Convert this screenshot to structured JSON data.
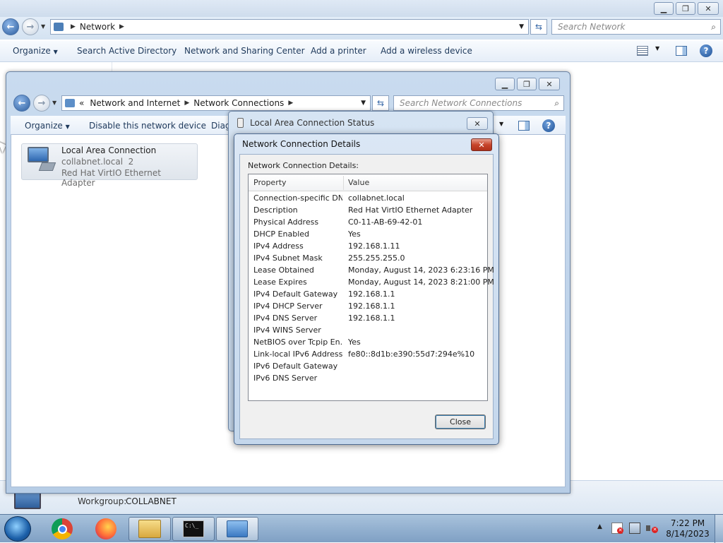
{
  "main_window": {
    "address_crumb": "Network",
    "search_placeholder": "Search Network",
    "commands": [
      "Organize",
      "Search Active Directory",
      "Network and Sharing Center",
      "Add a printer",
      "Add a wireless device"
    ],
    "status_workgroup_label": "Workgroup:",
    "status_workgroup_value": "COLLABNET"
  },
  "nc_window": {
    "breadcrumb_prefix": "«",
    "breadcrumb": [
      "Network and Internet",
      "Network Connections"
    ],
    "search_placeholder": "Search Network Connections",
    "commands": [
      "Organize",
      "Disable this network device",
      "Diag"
    ],
    "connection": {
      "name": "Local Area Connection",
      "network": "collabnet.local  2",
      "adapter": "Red Hat VirtIO Ethernet Adapter"
    }
  },
  "status_dialog": {
    "title": "Local Area Connection Status",
    "close_glyph": "✕"
  },
  "details_dialog": {
    "title": "Network Connection Details",
    "label": "Network Connection Details:",
    "columns": [
      "Property",
      "Value"
    ],
    "rows": [
      {
        "property": "Connection-specific DN...",
        "value": "collabnet.local"
      },
      {
        "property": "Description",
        "value": "Red Hat VirtIO Ethernet Adapter"
      },
      {
        "property": "Physical Address",
        "value": "C0-11-AB-69-42-01"
      },
      {
        "property": "DHCP Enabled",
        "value": "Yes"
      },
      {
        "property": "IPv4 Address",
        "value": "192.168.1.11"
      },
      {
        "property": "IPv4 Subnet Mask",
        "value": "255.255.255.0"
      },
      {
        "property": "Lease Obtained",
        "value": "Monday, August 14, 2023 6:23:16 PM"
      },
      {
        "property": "Lease Expires",
        "value": "Monday, August 14, 2023 8:21:00 PM"
      },
      {
        "property": "IPv4 Default Gateway",
        "value": "192.168.1.1"
      },
      {
        "property": "IPv4 DHCP Server",
        "value": "192.168.1.1"
      },
      {
        "property": "IPv4 DNS Server",
        "value": "192.168.1.1"
      },
      {
        "property": "IPv4 WINS Server",
        "value": ""
      },
      {
        "property": "NetBIOS over Tcpip En...",
        "value": "Yes"
      },
      {
        "property": "Link-local IPv6 Address",
        "value": "fe80::8d1b:e390:55d7:294e%10"
      },
      {
        "property": "IPv6 Default Gateway",
        "value": ""
      },
      {
        "property": "IPv6 DNS Server",
        "value": ""
      }
    ],
    "close_button": "Close"
  },
  "taskbar": {
    "icons": [
      "windows-start-icon",
      "chrome-icon",
      "firefox-icon",
      "file-explorer-icon",
      "command-prompt-icon",
      "network-connections-icon"
    ],
    "cmd_label": "C:\\_",
    "time": "7:22 PM",
    "date": "8/14/2023"
  }
}
